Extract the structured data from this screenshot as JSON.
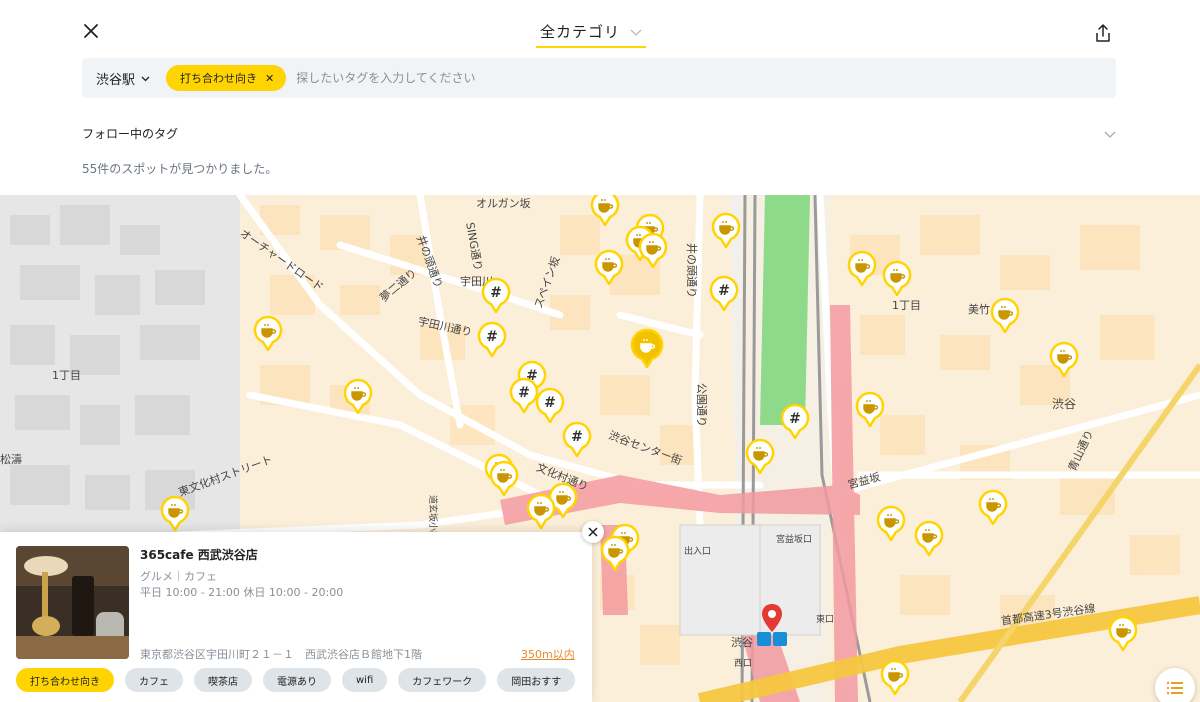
{
  "header": {
    "category_label": "全カテゴリ",
    "station_label": "渋谷駅",
    "active_tag": "打ち合わせ向き",
    "search_placeholder": "探したいタグを入力してください",
    "follow_label": "フォロー中のタグ",
    "result_text": "55件のスポットが見つかりました。"
  },
  "map": {
    "labels": [
      {
        "text": "オルガン坂"
      },
      {
        "text": "オーチャードロード"
      },
      {
        "text": "SING通り"
      },
      {
        "text": "井の頭通り"
      },
      {
        "text": "宇田川"
      },
      {
        "text": "夢二通り"
      },
      {
        "text": "宇田川通り"
      },
      {
        "text": "スペイン坂"
      },
      {
        "text": "井の頭通り"
      },
      {
        "text": "1丁目"
      },
      {
        "text": "1丁目"
      },
      {
        "text": "美竹"
      },
      {
        "text": "公園通り"
      },
      {
        "text": "渋谷センター街"
      },
      {
        "text": "文化村通り"
      },
      {
        "text": "東文化村ストリート"
      },
      {
        "text": "松濤"
      },
      {
        "text": "渋谷"
      },
      {
        "text": "宮益坂"
      },
      {
        "text": "宮益坂口"
      },
      {
        "text": "青山通り"
      },
      {
        "text": "首都高速3号渋谷線"
      },
      {
        "text": "出入口"
      },
      {
        "text": "渋谷"
      },
      {
        "text": "西口"
      },
      {
        "text": "東口"
      },
      {
        "text": "道玄坂小路"
      }
    ],
    "pin_types": {
      "cafe": "coffee-cup-icon",
      "tag": "hash-icon"
    }
  },
  "card": {
    "title": "365cafe 西武渋谷店",
    "genre": "グルメ｜カフェ",
    "hours": "平日 10:00 - 21:00 休日 10:00 - 20:00",
    "address": "東京都渋谷区宇田川町２１－１　西武渋谷店Ｂ館地下1階",
    "distance": "350m以内",
    "tags": [
      "打ち合わせ向き",
      "カフェ",
      "喫茶店",
      "電源あり",
      "wifi",
      "カフェワーク",
      "岡田おすす"
    ]
  },
  "colors": {
    "accent": "#ffd400",
    "distance": "#e8892d",
    "rail": "#f39aa0",
    "park": "#8ed98a",
    "block": "#fde9c6"
  }
}
